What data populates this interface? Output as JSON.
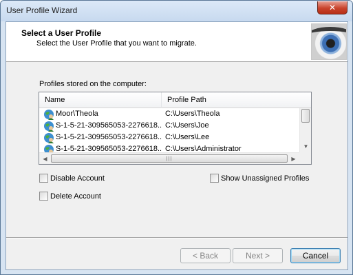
{
  "window": {
    "title": "User Profile Wizard",
    "close_glyph": "✕"
  },
  "header": {
    "title": "Select a User Profile",
    "subtitle": "Select the User Profile that you want to migrate.",
    "image_icon": "eye-icon"
  },
  "profiles": {
    "label": "Profiles stored on the computer:",
    "columns": [
      "Name",
      "Profile Path"
    ],
    "rows": [
      {
        "name": "Moor\\Theola",
        "path": "C:\\Users\\Theola"
      },
      {
        "name": "S-1-5-21-309565053-2276618...",
        "path": "C:\\Users\\Joe"
      },
      {
        "name": "S-1-5-21-309565053-2276618...",
        "path": "C:\\Users\\Lee"
      },
      {
        "name": "S-1-5-21-309565053-2276618...",
        "path": "C:\\Users\\Administrator"
      }
    ],
    "row_icon": "user-globe-icon",
    "scroll_up": "▲",
    "scroll_down": "▼",
    "scroll_left": "◀",
    "scroll_right": "▶",
    "thumb_grip": "|||"
  },
  "options": {
    "disable_account": "Disable Account",
    "delete_account": "Delete Account",
    "show_unassigned": "Show Unassigned Profiles"
  },
  "buttons": {
    "back": "< Back",
    "next": "Next >",
    "cancel": "Cancel"
  },
  "colors": {
    "title_bar": "#c7d9ef",
    "close_button": "#c9432c",
    "default_button_border": "#3c7fb1"
  }
}
